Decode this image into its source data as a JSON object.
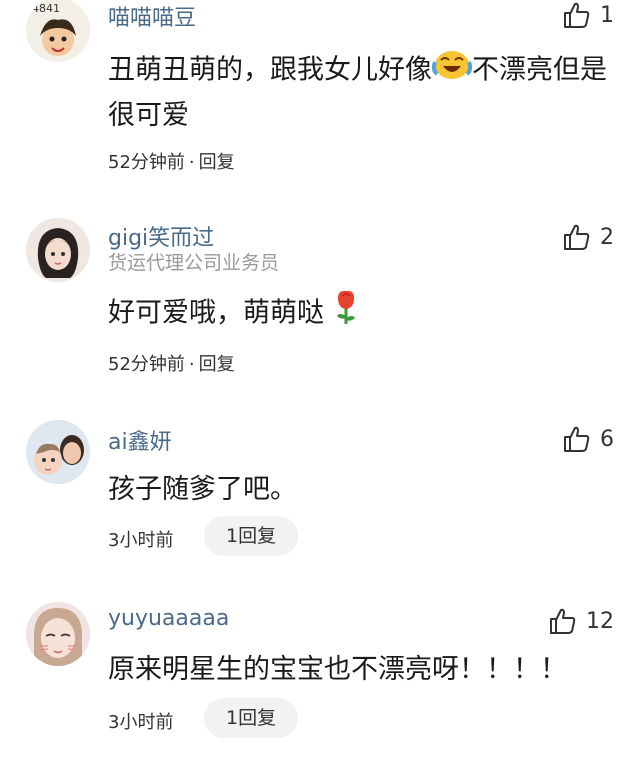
{
  "comments": [
    {
      "username": "喵喵喵豆",
      "avatar_text": "4841",
      "text_part1": "丑萌丑萌的，跟我女儿好像",
      "text_part2": "不漂亮但是很可爱",
      "emoji": "crying-laughing-face",
      "time": "52分钟前",
      "reply_label": "回复",
      "likes": "1"
    },
    {
      "username": "gigi笑而过",
      "subtitle": "货运代理公司业务员",
      "text": "好可爱哦，萌萌哒",
      "emoji": "rose",
      "time": "52分钟前",
      "reply_label": "回复",
      "likes": "2"
    },
    {
      "username": "ai鑫妍",
      "text": "孩子随爹了吧。",
      "time": "3小时前",
      "reply_label": "1回复",
      "likes": "6"
    },
    {
      "username": "yuyuaaaaa",
      "text": "原来明星生的宝宝也不漂亮呀！！！！",
      "time": "3小时前",
      "reply_label": "1回复",
      "likes": "12"
    }
  ],
  "colors": {
    "username": "#4a6a8a",
    "reply_pill_bg": "#f2f2f2",
    "subtitle": "#9a9a9a"
  }
}
